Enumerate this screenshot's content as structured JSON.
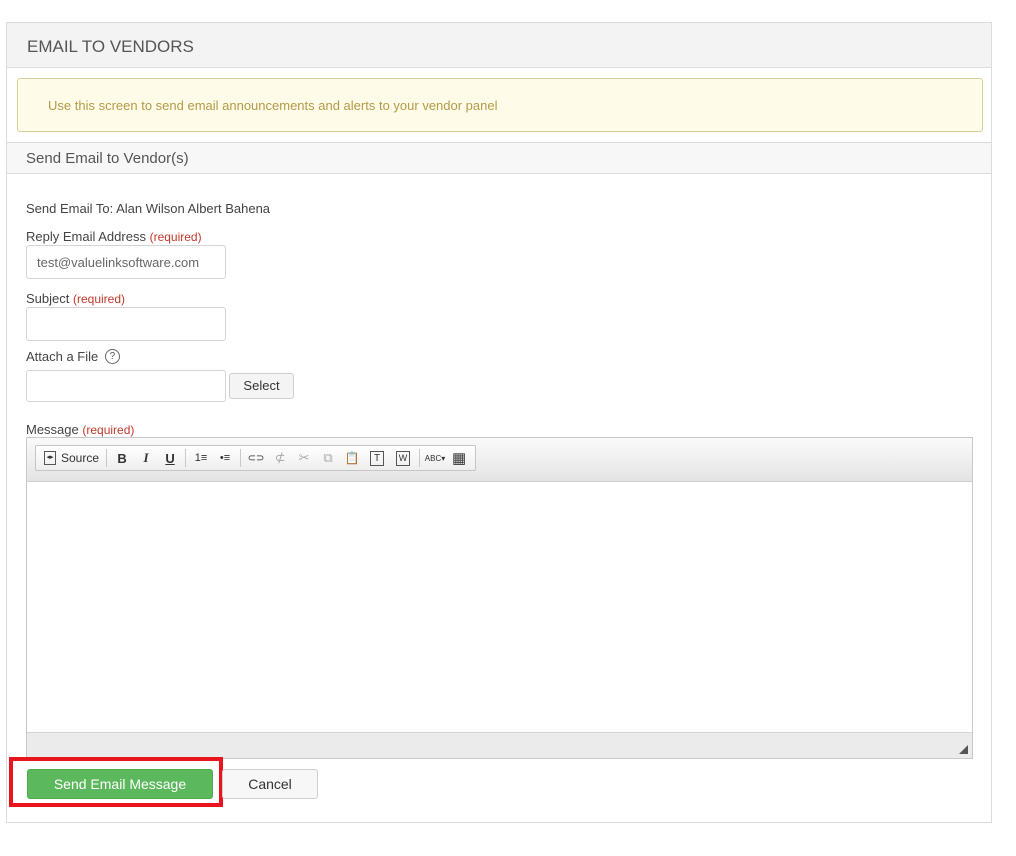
{
  "panel": {
    "title": "EMAIL TO VENDORS"
  },
  "alert": {
    "text": "Use this screen to send email announcements and alerts to your vendor panel"
  },
  "section": {
    "title": "Send Email to Vendor(s)"
  },
  "form": {
    "send_to_label": "Send Email To:",
    "send_to_value": "Alan Wilson Albert Bahena",
    "required_text": "(required)",
    "reply": {
      "label": "Reply Email Address",
      "value": "test@valuelinksoftware.com"
    },
    "subject": {
      "label": "Subject",
      "value": ""
    },
    "attach": {
      "label": "Attach a File",
      "help_icon": "?",
      "select_label": "Select",
      "value": ""
    },
    "message": {
      "label": "Message"
    }
  },
  "toolbar": {
    "source_label": "Source",
    "bold": "B",
    "italic": "I",
    "underline": "U",
    "numbered_list": "1≡",
    "bulleted_list": "•≡",
    "link": "⊂⊃",
    "unlink": "⊄",
    "cut": "✂",
    "copy": "⧉",
    "paste": "📋",
    "paste_text": "T",
    "paste_word": "W",
    "spellcheck": "ABC▾",
    "table": "▦"
  },
  "actions": {
    "send_label": "Send Email Message",
    "cancel_label": "Cancel"
  },
  "colors": {
    "send_button": "#5cb85c",
    "highlight": "#e8141e",
    "required": "#c0392b",
    "alert_bg": "#fefbe8"
  }
}
